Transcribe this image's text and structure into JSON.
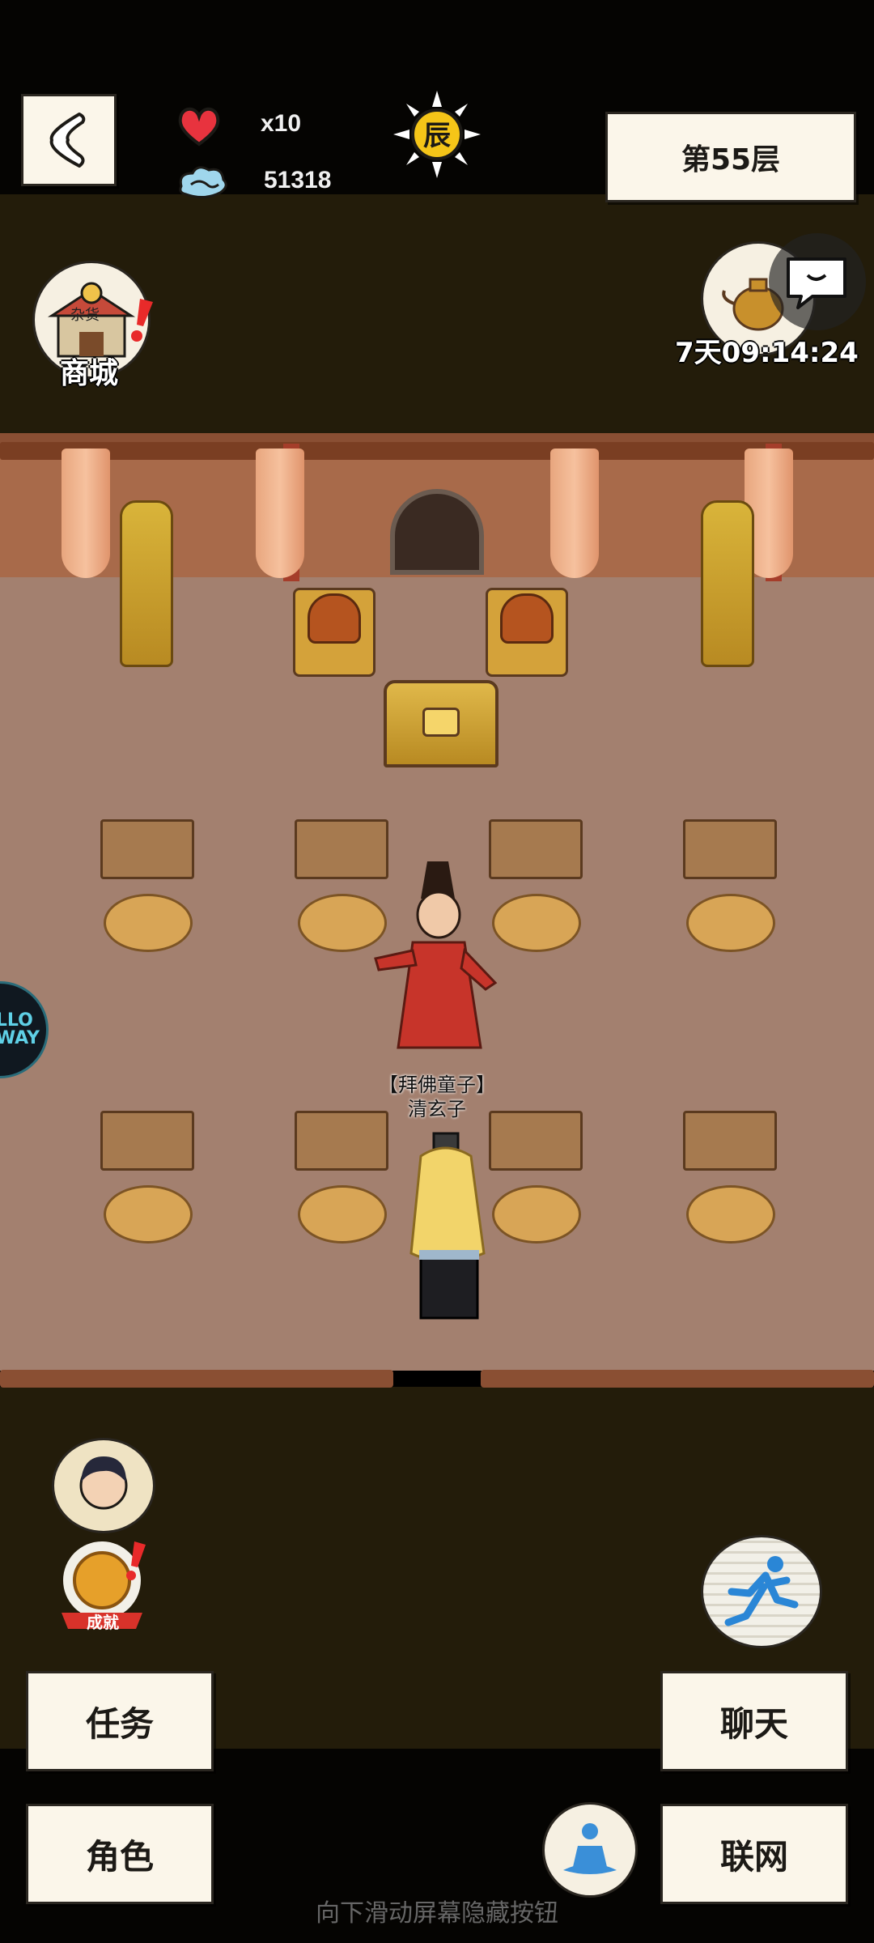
{
  "hud": {
    "lives": "x10",
    "spirit": "51318",
    "time_badge": "辰",
    "floor_label": "第55层"
  },
  "shop": {
    "label": "商城",
    "sign": "杂货"
  },
  "event": {
    "timer": "7天09:14:24"
  },
  "npc": {
    "title": "【拜佛童子】",
    "name": "清玄子"
  },
  "achievement": {
    "label": "成就"
  },
  "buttons": {
    "tasks": "任务",
    "character": "角色",
    "chat": "聊天",
    "network": "联网"
  },
  "hint": "向下滑动屏幕隐藏按钮",
  "side_tab": "LLO\nWAY",
  "colors": {
    "paper": "#fbf6ea",
    "dark": "#231c0a",
    "floor": "#a3806f",
    "wall": "#a86a4a",
    "heart": "#e8333e"
  },
  "icons": [
    "back-arrow-icon",
    "heart-icon",
    "spirit-cloud-icon",
    "sun-icon",
    "shop-icon",
    "teapot-icon",
    "chat-bubble-icon",
    "runner-icon",
    "meditation-icon",
    "exclamation-icon"
  ]
}
